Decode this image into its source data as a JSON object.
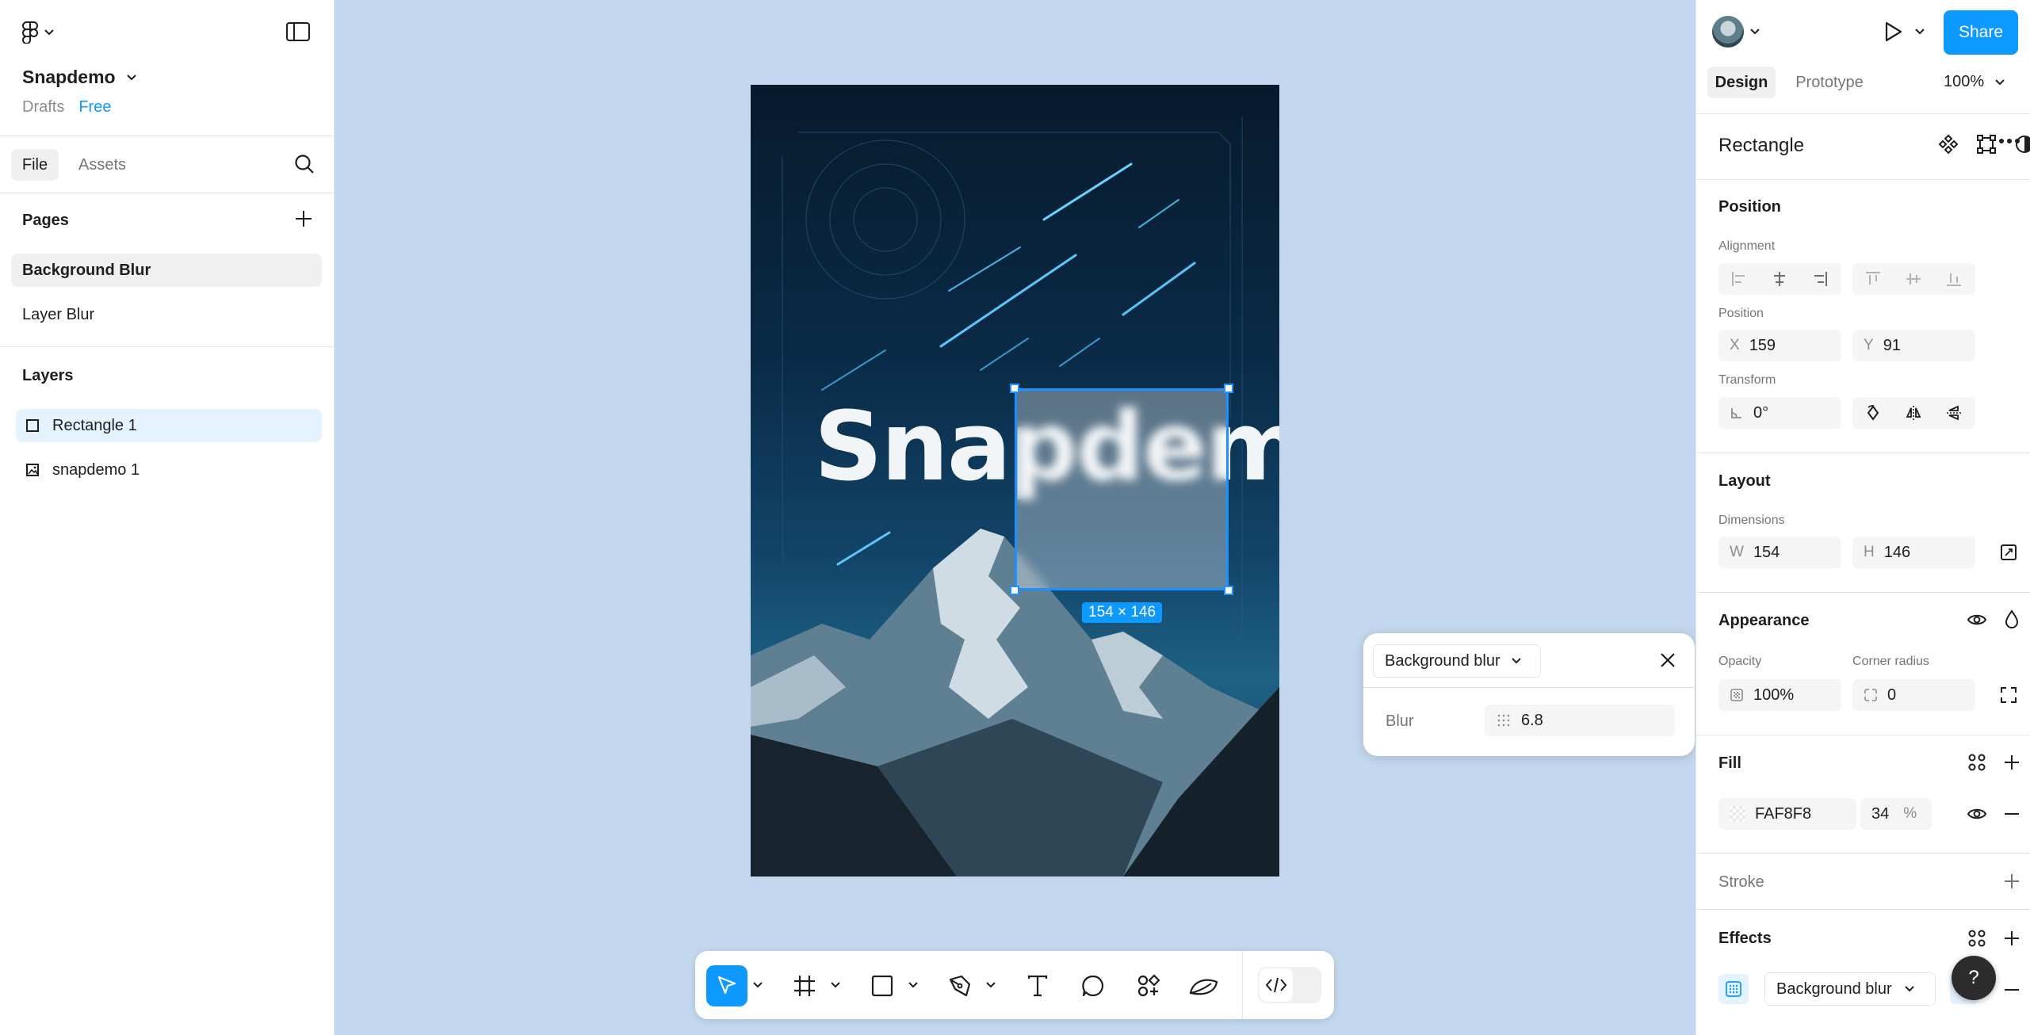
{
  "left": {
    "file_name": "Snapdemo",
    "location": "Drafts",
    "plan_badge": "Free",
    "tabs": [
      "File",
      "Assets"
    ],
    "pages_title": "Pages",
    "pages": [
      "Background Blur",
      "Layer Blur"
    ],
    "layers_title": "Layers",
    "layers": [
      "Rectangle 1",
      "snapdemo 1"
    ]
  },
  "canvas": {
    "artwork_text": "Snapdemo",
    "selection_size": "154 × 146",
    "blur_popover": {
      "effect_type": "Background blur",
      "blur_label": "Blur",
      "blur_value": "6.8"
    }
  },
  "toolbar": {
    "tools": [
      "move-tool",
      "frame-tool",
      "shape-tool",
      "pen-tool",
      "text-tool",
      "comment-tool",
      "actions-tool",
      "ai-tool",
      "dev-mode-toggle"
    ]
  },
  "right": {
    "share_label": "Share",
    "tabs": [
      "Design",
      "Prototype"
    ],
    "zoom": "100%",
    "selection_type": "Rectangle",
    "position": {
      "title": "Position",
      "alignment_label": "Alignment",
      "position_label": "Position",
      "x_label": "X",
      "x": "159",
      "y_label": "Y",
      "y": "91",
      "transform_label": "Transform",
      "rotation": "0°"
    },
    "layout": {
      "title": "Layout",
      "dimensions_label": "Dimensions",
      "w_label": "W",
      "w": "154",
      "h_label": "H",
      "h": "146"
    },
    "appearance": {
      "title": "Appearance",
      "opacity_label": "Opacity",
      "opacity": "100%",
      "radius_label": "Corner radius",
      "radius": "0"
    },
    "fill": {
      "title": "Fill",
      "hex": "FAF8F8",
      "alpha": "34",
      "percent": "%"
    },
    "stroke": {
      "title": "Stroke"
    },
    "effects": {
      "title": "Effects",
      "effect": "Background blur"
    },
    "help": "?"
  },
  "colors": {
    "accent": "#0d99ff",
    "canvas_bg": "#c3d8ee",
    "fill_swatch": "#FAF8F8"
  }
}
